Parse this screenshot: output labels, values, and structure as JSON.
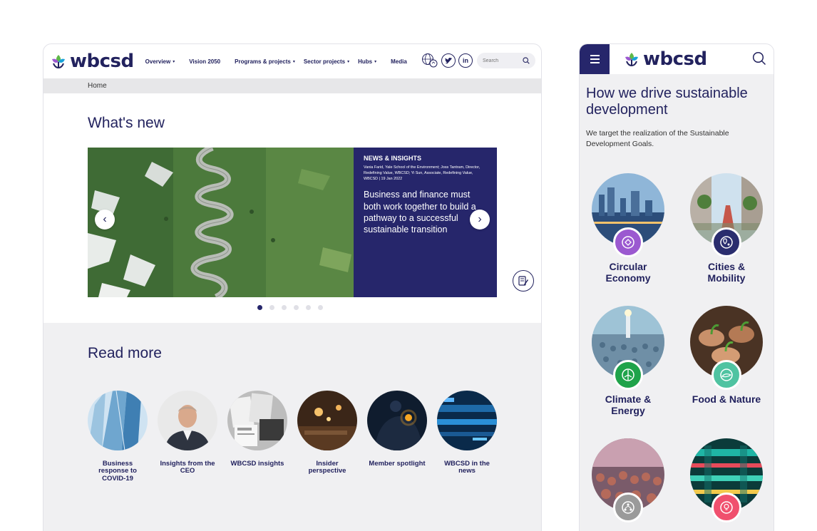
{
  "desktop": {
    "logo_text": "wbcsd",
    "nav": [
      {
        "label": "Overview",
        "caret": true
      },
      {
        "label": "Vision 2050",
        "caret": false
      },
      {
        "label": "Programs & projects",
        "caret": true
      },
      {
        "label": "Sector projects",
        "caret": true
      },
      {
        "label": "Hubs",
        "caret": true
      },
      {
        "label": "Media",
        "caret": false
      }
    ],
    "search_placeholder": "Search",
    "social": {
      "twitter": "🐦",
      "linkedin": "in"
    },
    "breadcrumb": "Home",
    "whats_new": {
      "title": "What's new",
      "category": "NEWS & INSIGHTS",
      "meta": "Vania Farid, Yale School of the Environment; Joss Tantram, Director, Redefining Value, WBCSD; Yi Sun, Associate, Redefining Value, WBCSD | 19 Jan 2022",
      "headline": "Business and finance must both work together to build a pathway to a successful sustainable transition",
      "slides": 6,
      "active_slide": 1
    },
    "read_more": {
      "title": "Read more",
      "items": [
        {
          "label": "Business response to COVID-19"
        },
        {
          "label": "Insights from the CEO"
        },
        {
          "label": "WBCSD insights"
        },
        {
          "label": "Insider perspective"
        },
        {
          "label": "Member spotlight"
        },
        {
          "label": "WBCSD in the news"
        }
      ]
    }
  },
  "mobile": {
    "logo_text": "wbcsd",
    "title": "How we drive sustainable development",
    "description": "We target the realization of the Sustainable Development Goals.",
    "goals": [
      {
        "label": "Circular Economy",
        "badge_color": "#9b59d0"
      },
      {
        "label": "Cities & Mobility",
        "badge_color": "#2a2d6e"
      },
      {
        "label": "Climate & Energy",
        "badge_color": "#1fa34a"
      },
      {
        "label": "Food & Nature",
        "badge_color": "#4fc3a1"
      },
      {
        "label": "",
        "badge_color": "#9a9a9a"
      },
      {
        "label": "",
        "badge_color": "#f0506e"
      }
    ]
  },
  "colors": {
    "brand_navy": "#26266b",
    "bg_gray": "#f0f0f2"
  }
}
